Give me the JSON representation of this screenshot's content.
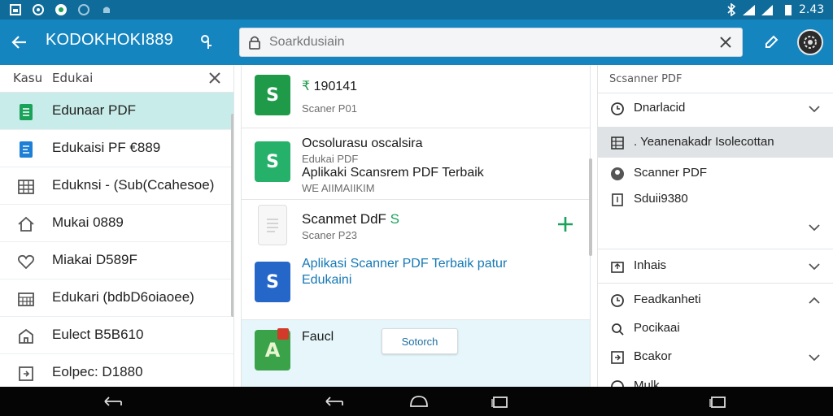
{
  "status_bar": {
    "time": "2.43",
    "icons": [
      "gallery-icon",
      "whatsapp-icon",
      "refresh-icon",
      "location-icon",
      "android-icon",
      "bluetooth-icon",
      "signal-icon",
      "wifi-icon",
      "battery-icon"
    ]
  },
  "app_bar": {
    "title": "KODOKHOKI889",
    "search_placeholder": "Soarkdusiain"
  },
  "left_panel": {
    "header_left": "Kasu",
    "header_title": "Edukai",
    "items": [
      {
        "label": "Edunaar PDF",
        "icon": "sheet-icon",
        "color": "#1aa25a"
      },
      {
        "label": "Edukaisi PF €889",
        "icon": "doc-icon",
        "color": "#1d7fd6"
      },
      {
        "label": "Eduknsi - (Sub(Ccahesoe)",
        "icon": "grid-icon",
        "color": "#555555"
      },
      {
        "label": "Mukai 0889",
        "icon": "home-icon",
        "color": "#555555"
      },
      {
        "label": "Miakai D589F",
        "icon": "heart-icon",
        "color": "#555555"
      },
      {
        "label": "Edukari (bdbD6oiaoee)",
        "icon": "calendar-icon",
        "color": "#555555"
      },
      {
        "label": "Eulect B5B610",
        "icon": "building-icon",
        "color": "#555555"
      },
      {
        "label": "Eolpec: D1880",
        "icon": "export-icon",
        "color": "#555555"
      }
    ]
  },
  "middle_panel": {
    "cards": [
      {
        "title_prefix": "₹",
        "title": "190141",
        "subtitle": "Scaner P01",
        "icon": "S",
        "color": "#1e9a48"
      },
      {
        "title": "Ocsolurasu oscalsira",
        "line2": "Edukai PDF",
        "line3": "Aplikaki Scansrem PDF Terbaik",
        "line4": "WE AIIMAIIKIM",
        "icon": "S",
        "color": "#25b169"
      },
      {
        "title": "Scanmet DdF",
        "title_suffix": "S",
        "subtitle": "Scaner P23",
        "icon": "doc-icon",
        "color": "#e6e6e6"
      },
      {
        "title": "Aplikasi Scanner PDF Terbaik patur",
        "subtitle": "Edukaini",
        "icon": "S",
        "color": "#2567c9"
      },
      {
        "title": "Faucl",
        "button": "Sotorch",
        "icon": "A",
        "color": "#3aa34a"
      }
    ]
  },
  "right_panel": {
    "header": "Scsanner PDF",
    "items": [
      {
        "label": "Dnarlacid",
        "icon": "clock-icon",
        "chevron": "down"
      },
      {
        "label": ". Yeanenakadr Isolecottan",
        "icon": "grid-icon",
        "chevron": "none"
      },
      {
        "label": "Scanner PDF",
        "icon": "user-icon",
        "chevron": "none"
      },
      {
        "label": "Sduii9380",
        "icon": "page-icon",
        "chevron": "none"
      },
      {
        "label": "",
        "icon": "none",
        "chevron": "down"
      },
      {
        "label": "Inhais",
        "icon": "upload-icon",
        "chevron": "down"
      },
      {
        "label": "Feadkanheti",
        "icon": "clock-icon",
        "chevron": "up"
      },
      {
        "label": "Pocikaai",
        "icon": "search-icon",
        "chevron": "none"
      },
      {
        "label": "Bcakor",
        "icon": "export-icon",
        "chevron": "down"
      },
      {
        "label": "Mulk",
        "icon": "clock-icon",
        "chevron": "none"
      }
    ]
  }
}
